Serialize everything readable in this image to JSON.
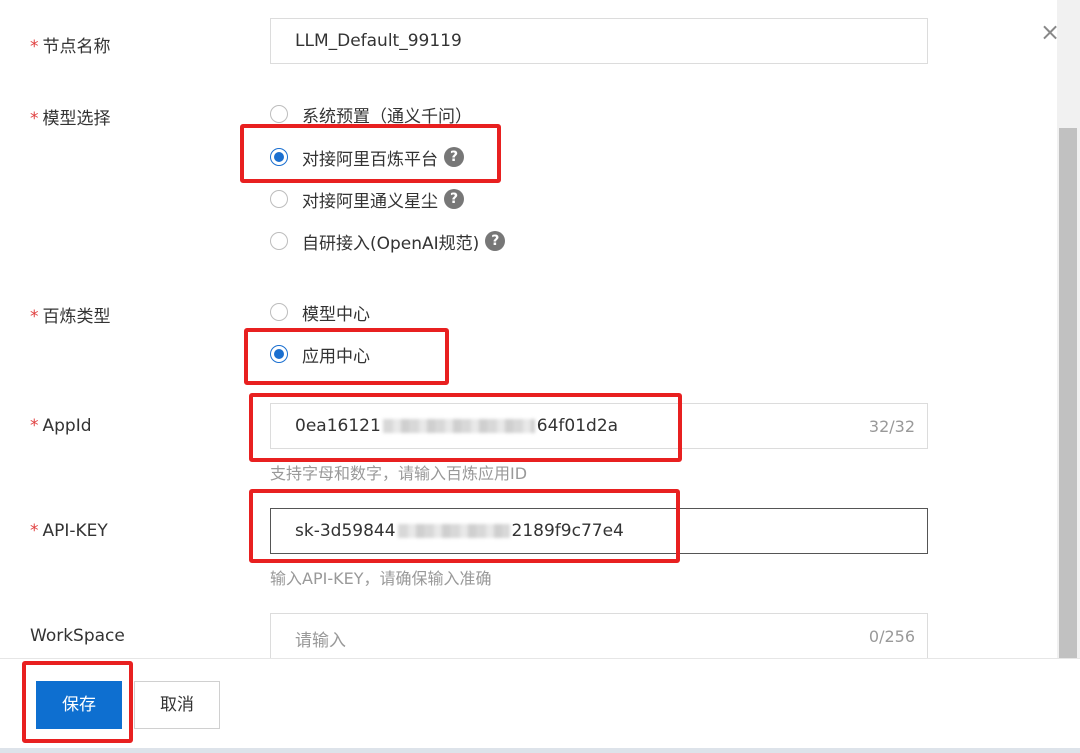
{
  "dialog": {
    "close_icon": "×"
  },
  "fields": {
    "node_name": {
      "required_mark": "*",
      "label": "节点名称",
      "value": "LLM_Default_99119"
    },
    "model_select": {
      "required_mark": "*",
      "label": "模型选择",
      "options": [
        {
          "label": "系统预置（通义千问）",
          "checked": false,
          "help": false
        },
        {
          "label": "对接阿里百炼平台",
          "checked": true,
          "help": true
        },
        {
          "label": "对接阿里通义星尘",
          "checked": false,
          "help": true
        },
        {
          "label": "自研接入(OpenAI规范)",
          "checked": false,
          "help": true
        }
      ]
    },
    "bailian_type": {
      "required_mark": "*",
      "label": "百炼类型",
      "options": [
        {
          "label": "模型中心",
          "checked": false
        },
        {
          "label": "应用中心",
          "checked": true
        }
      ]
    },
    "app_id": {
      "required_mark": "*",
      "label": "AppId",
      "value_prefix": "0ea16121",
      "value_suffix": "64f01d2a",
      "count": "32/32",
      "hint": "支持字母和数字，请输入百炼应用ID"
    },
    "api_key": {
      "required_mark": "*",
      "label": "API-KEY",
      "value_prefix": "sk-3d59844",
      "value_suffix": "2189f9c77e4",
      "hint": "输入API-KEY，请确保输入准确"
    },
    "workspace": {
      "label": "WorkSpace",
      "placeholder": "请输入",
      "count": "0/256"
    }
  },
  "footer": {
    "save_label": "保存",
    "cancel_label": "取消"
  },
  "help_icon_glyph": "?",
  "colors": {
    "primary": "#0e6fd0",
    "required": "#e04040",
    "annotation_box": "#e82020"
  }
}
